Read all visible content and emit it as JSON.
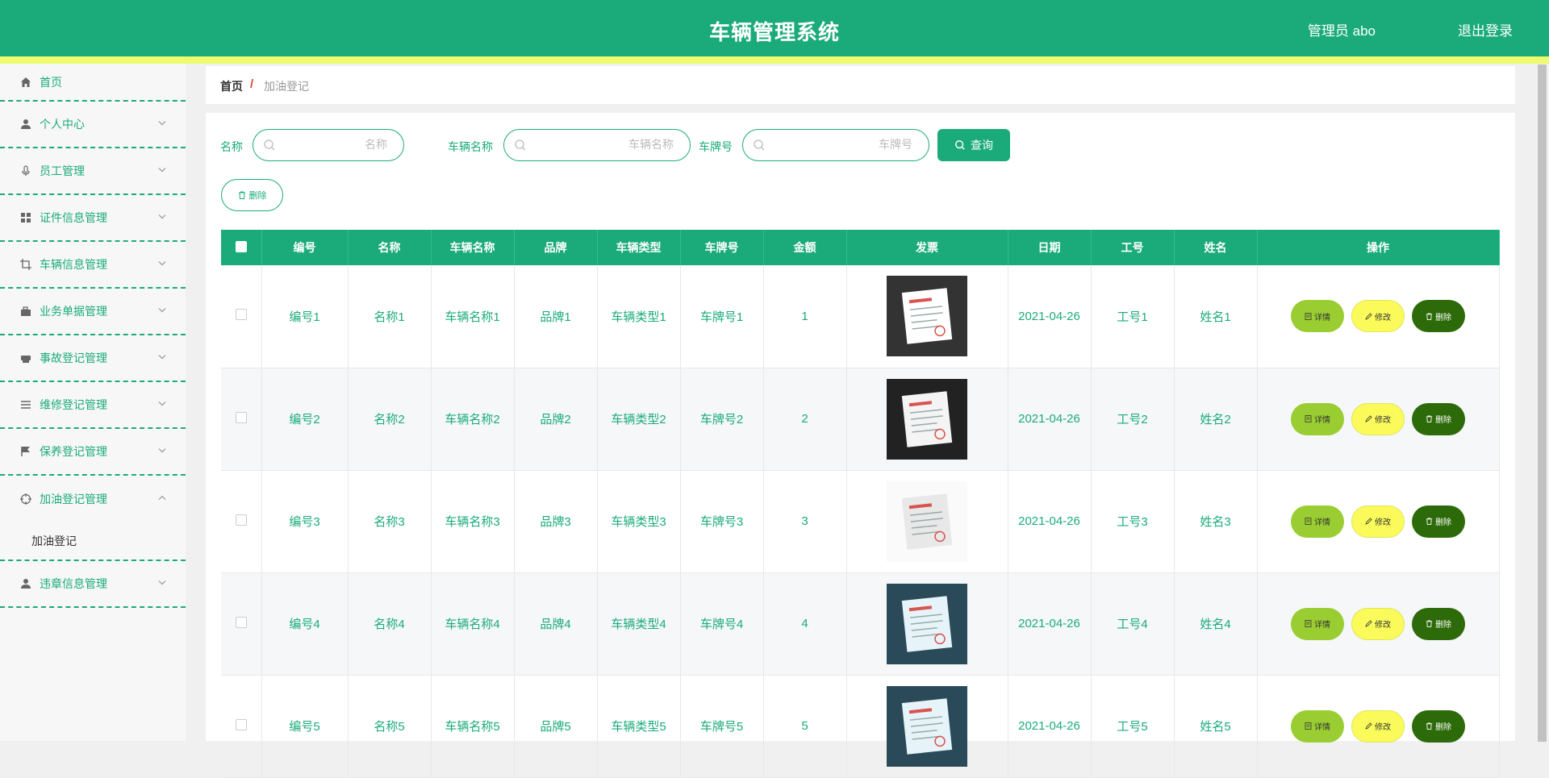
{
  "header": {
    "title": "车辆管理系统",
    "user": "管理员 abo",
    "logout": "退出登录"
  },
  "sidebar": {
    "items": [
      {
        "label": "首页",
        "icon": "home-icon"
      },
      {
        "label": "个人中心",
        "icon": "user-icon"
      },
      {
        "label": "员工管理",
        "icon": "microphone-icon"
      },
      {
        "label": "证件信息管理",
        "icon": "grid-icon"
      },
      {
        "label": "车辆信息管理",
        "icon": "crop-icon"
      },
      {
        "label": "业务单据管理",
        "icon": "suitcase-icon"
      },
      {
        "label": "事故登记管理",
        "icon": "printer-icon"
      },
      {
        "label": "维修登记管理",
        "icon": "list-icon"
      },
      {
        "label": "保养登记管理",
        "icon": "flag-icon"
      },
      {
        "label": "加油登记管理",
        "icon": "target-icon",
        "sub": "加油登记"
      },
      {
        "label": "违章信息管理",
        "icon": "user-icon"
      }
    ]
  },
  "breadcrumb": {
    "home": "首页",
    "separator": "/",
    "current": "加油登记"
  },
  "search": {
    "fields": [
      {
        "label": "名称",
        "placeholder": "名称"
      },
      {
        "label": "车辆名称",
        "placeholder": "车辆名称"
      },
      {
        "label": "车牌号",
        "placeholder": "车牌号"
      }
    ],
    "button": "查询"
  },
  "actions": {
    "delete": "删除"
  },
  "table": {
    "headers": [
      "编号",
      "名称",
      "车辆名称",
      "品牌",
      "车辆类型",
      "车牌号",
      "金额",
      "发票",
      "日期",
      "工号",
      "姓名",
      "操作"
    ],
    "rows": [
      {
        "id": "编号1",
        "name": "名称1",
        "vehicle": "车辆名称1",
        "brand": "品牌1",
        "type": "车辆类型1",
        "plate": "车牌号1",
        "amount": "1",
        "date": "2021-04-26",
        "emp": "工号1",
        "person": "姓名1"
      },
      {
        "id": "编号2",
        "name": "名称2",
        "vehicle": "车辆名称2",
        "brand": "品牌2",
        "type": "车辆类型2",
        "plate": "车牌号2",
        "amount": "2",
        "date": "2021-04-26",
        "emp": "工号2",
        "person": "姓名2"
      },
      {
        "id": "编号3",
        "name": "名称3",
        "vehicle": "车辆名称3",
        "brand": "品牌3",
        "type": "车辆类型3",
        "plate": "车牌号3",
        "amount": "3",
        "date": "2021-04-26",
        "emp": "工号3",
        "person": "姓名3"
      },
      {
        "id": "编号4",
        "name": "名称4",
        "vehicle": "车辆名称4",
        "brand": "品牌4",
        "type": "车辆类型4",
        "plate": "车牌号4",
        "amount": "4",
        "date": "2021-04-26",
        "emp": "工号4",
        "person": "姓名4"
      },
      {
        "id": "编号5",
        "name": "名称5",
        "vehicle": "车辆名称5",
        "brand": "品牌5",
        "type": "车辆类型5",
        "plate": "车牌号5",
        "amount": "5",
        "date": "2021-04-26",
        "emp": "工号5",
        "person": "姓名5"
      }
    ],
    "ops": {
      "detail": "详情",
      "edit": "修改",
      "remove": "删除"
    }
  },
  "colors": {
    "primary": "#1bab7a",
    "strip": "#eefb6e",
    "detail": "#9acd32",
    "edit": "#fafb5b",
    "remove": "#2d6a0a"
  }
}
